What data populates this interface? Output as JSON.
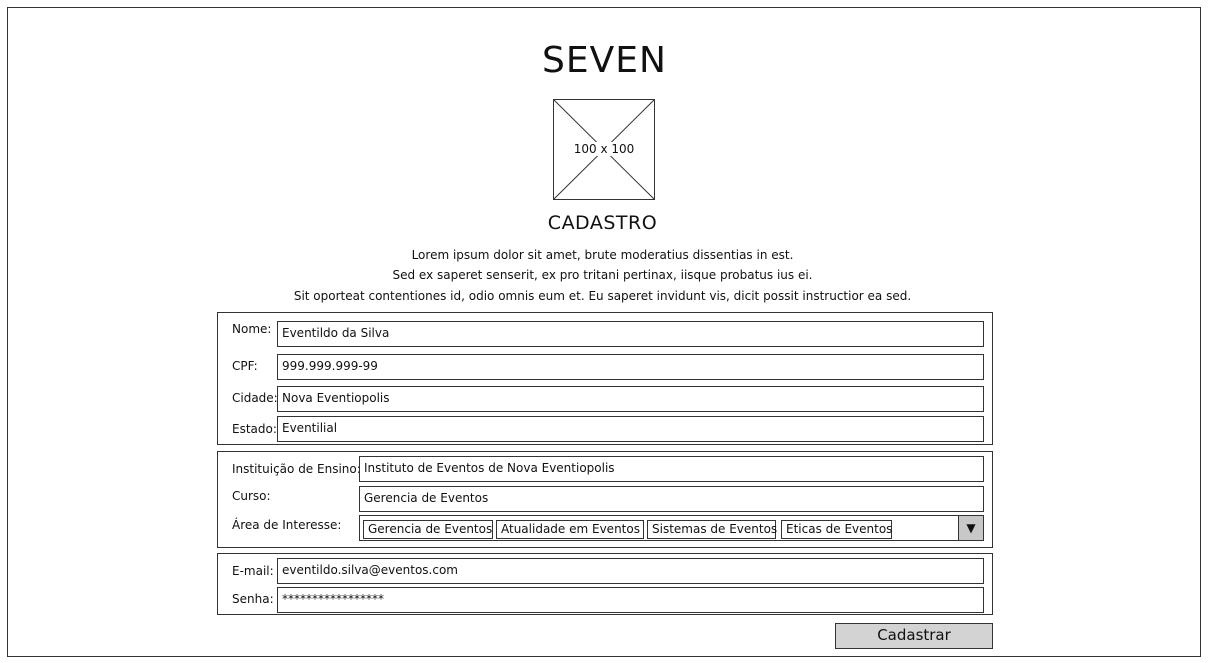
{
  "header": {
    "title": "SEVEN",
    "image_placeholder_label": "100 x 100",
    "subtitle": "CADASTRO",
    "description_lines": [
      "Lorem ipsum dolor sit amet, brute moderatius dissentias in est.",
      "Sed ex saperet senserit, ex pro tritani pertinax, iisque probatus ius ei.",
      "Sit oporteat contentiones id, odio omnis eum et. Eu saperet invidunt vis, dicit possit instructior ea sed."
    ]
  },
  "personal": {
    "nome_label": "Nome:",
    "nome_value": "Eventildo da Silva",
    "cpf_label": "CPF:",
    "cpf_value": "999.999.999-99",
    "cidade_label": "Cidade:",
    "cidade_value": "Nova Eventiopolis",
    "estado_label": "Estado:",
    "estado_value": "Eventilial"
  },
  "academic": {
    "instituicao_label": "Instituição de Ensino:",
    "instituicao_value": "Instituto de Eventos de Nova Eventiopolis",
    "curso_label": "Curso:",
    "curso_value": "Gerencia de Eventos",
    "area_label": "Área de Interesse:",
    "area_values": [
      "Gerencia de Eventos",
      "Atualidade em Eventos",
      "Sistemas de Eventos",
      "Eticas de Eventos"
    ],
    "dropdown_icon": "triangle-down-icon"
  },
  "account": {
    "email_label": "E-mail:",
    "email_value": "eventildo.silva@eventos.com",
    "senha_label": "Senha:",
    "senha_value": "*****************"
  },
  "actions": {
    "submit_label": "Cadastrar"
  }
}
